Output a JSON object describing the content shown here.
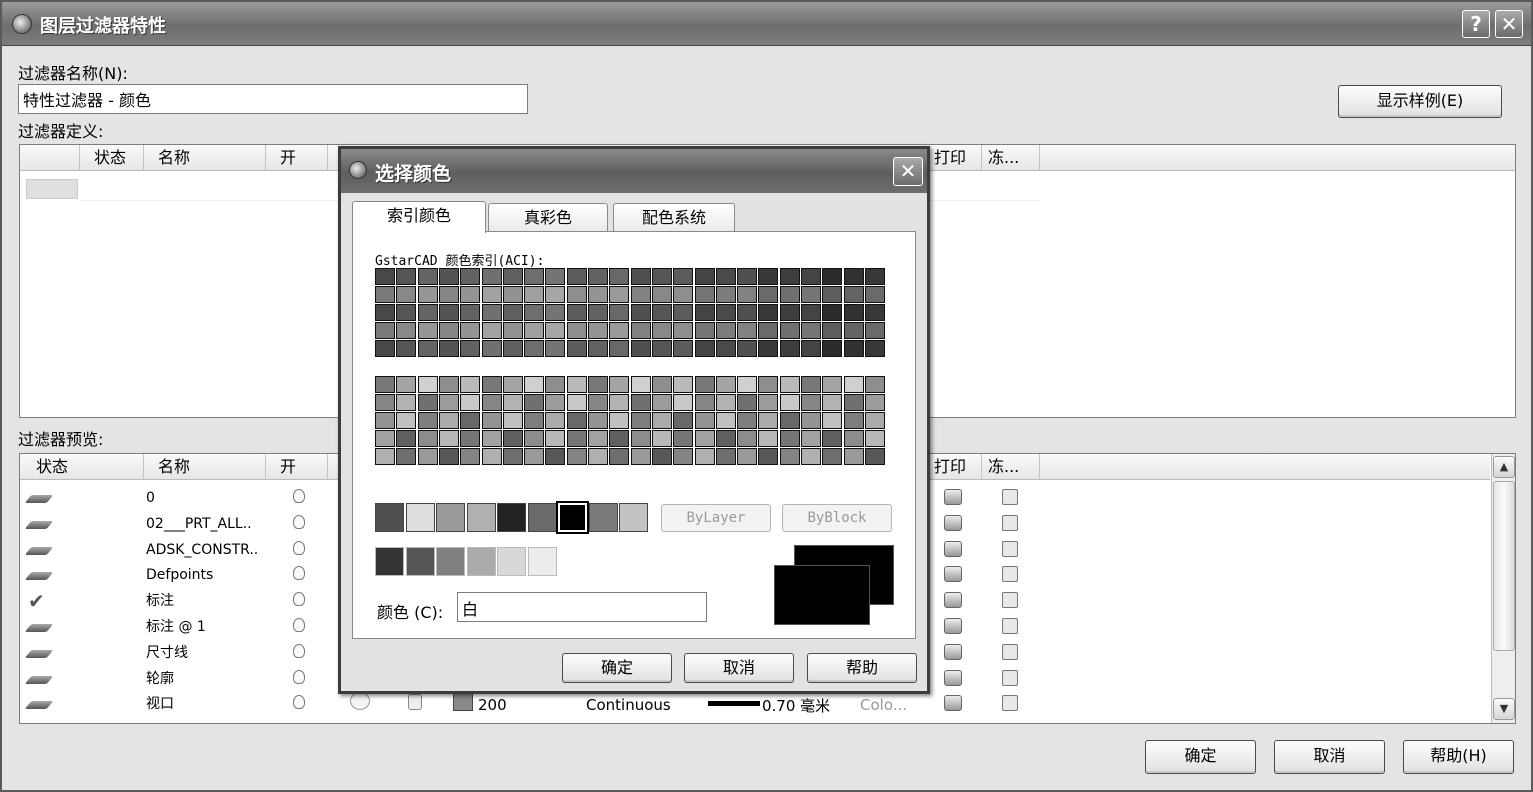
{
  "window": {
    "title": "图层过滤器特性",
    "help_label": "?",
    "close_label": "✕"
  },
  "filter_name": {
    "label": "过滤器名称(N):",
    "value": "特性过滤器 - 颜色"
  },
  "show_example_button": "显示样例(E)",
  "definition": {
    "label": "过滤器定义:",
    "columns": [
      "状态",
      "名称",
      "开"
    ],
    "right_columns": [
      "打印",
      "冻..."
    ]
  },
  "preview": {
    "label": "过滤器预览:",
    "columns": [
      "状态",
      "名称",
      "开"
    ],
    "right_columns": [
      "打印",
      "冻..."
    ],
    "rows": [
      {
        "name": "0",
        "status": "layer"
      },
      {
        "name": "02___PRT_ALL..",
        "status": "layer"
      },
      {
        "name": "ADSK_CONSTR..",
        "status": "layer"
      },
      {
        "name": "Defpoints",
        "status": "layer"
      },
      {
        "name": "标注",
        "status": "current"
      },
      {
        "name": "标注 @ 1",
        "status": "layer"
      },
      {
        "name": "尺寸线",
        "status": "layer"
      },
      {
        "name": "轮廓",
        "status": "layer"
      },
      {
        "name": "视口",
        "status": "layer"
      }
    ],
    "visible_row_detail": {
      "color": "200",
      "linetype": "Continuous",
      "lineweight": "0.70 毫米",
      "plot_style": "Colo..."
    }
  },
  "bottom_buttons": {
    "ok": "确定",
    "cancel": "取消",
    "help": "帮助(H)"
  },
  "color_dialog": {
    "title": "选择颜色",
    "close_label": "✕",
    "tabs": [
      "索引颜色",
      "真彩色",
      "配色系统"
    ],
    "active_tab": "索引颜色",
    "aci_label": "GstarCAD 颜色索引(ACI):",
    "bylayer_label": "ByLayer",
    "byblock_label": "ByBlock",
    "color_label": "颜色 (C):",
    "color_value": "白",
    "selected_color": "#000000",
    "ok_label": "确定",
    "cancel_label": "取消",
    "help_label": "帮助",
    "standard_colors": [
      "#505050",
      "#dedede",
      "#9a9a9a",
      "#b0b0b0",
      "#222222",
      "#6a6a6a",
      "#000000",
      "#7a7a7a",
      "#c2c2c2"
    ],
    "gray_shades": [
      "#333333",
      "#555555",
      "#808080",
      "#aaaaaa",
      "#d8d8d8",
      "#ececec"
    ]
  }
}
